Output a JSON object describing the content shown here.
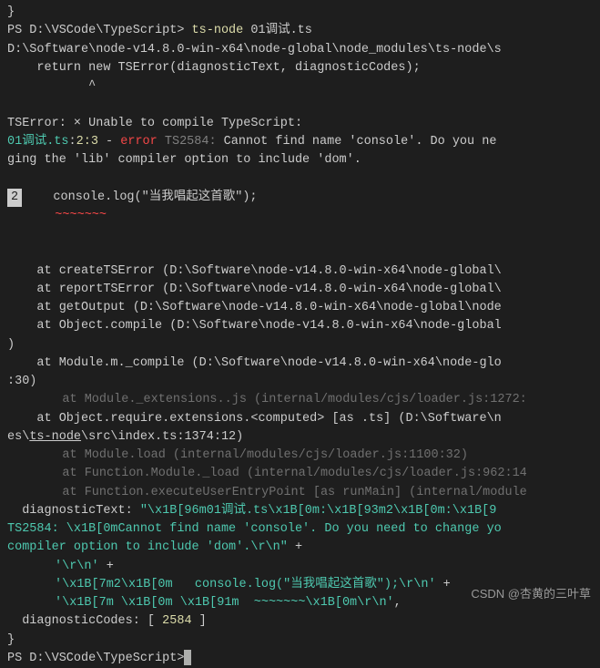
{
  "top": {
    "brace": "}",
    "prompt1": "PS D:\\VSCode\\TypeScript> ",
    "cmd": "ts-node",
    "arg": " 01调试.ts",
    "path": "D:\\Software\\node-v14.8.0-win-x64\\node-global\\node_modules\\ts-node\\s",
    "return_line": "    return new TSError(diagnosticText, diagnosticCodes);",
    "caret": "           ^"
  },
  "err": {
    "hdr": "TSError: × Unable to compile TypeScript:",
    "file": "01调试.ts",
    "loc_colon1": ":",
    "loc_line": "2",
    "loc_col": ":3",
    "dash": " - ",
    "error_word": "error",
    "code": " TS2584:",
    "msg1": " Cannot find name 'console'. Do you ne",
    "msg2": "ging the 'lib' compiler option to include 'dom'."
  },
  "code": {
    "gutter": "2",
    "line": "   console.log(\"当我唱起这首歌\");",
    "squiggle": "   ~~~~~~~"
  },
  "stack": {
    "s1": "    at createTSError (D:\\Software\\node-v14.8.0-win-x64\\node-global\\",
    "s2": "    at reportTSError (D:\\Software\\node-v14.8.0-win-x64\\node-global\\",
    "s3": "    at getOutput (D:\\Software\\node-v14.8.0-win-x64\\node-global\\node",
    "s4": "    at Object.compile (D:\\Software\\node-v14.8.0-win-x64\\node-global",
    "paren": ")",
    "s5": "    at Module.m._compile (D:\\Software\\node-v14.8.0-win-x64\\node-glo",
    "s5b": ":30)",
    "i1": "    at Module._extensions..js (internal/modules/cjs/loader.js:1272:",
    "s6a": "    at Object.require.extensions.<computed> [as .ts] (D:\\Software\\n",
    "s6b_pre": "es\\",
    "s6b_ul": "ts-node",
    "s6b_post": "\\src\\index.ts:1374:12)",
    "i2": "    at Module.load (internal/modules/cjs/loader.js:1100:32)",
    "i3": "    at Function.Module._load (internal/modules/cjs/loader.js:962:14",
    "i4": "    at Function.executeUserEntryPoint [as runMain] (internal/module"
  },
  "diag": {
    "dt_label": "  diagnosticText: ",
    "dt1": "\"\\x1B[96m01调试.ts\\x1B[0m:\\x1B[93m2\\x1B[0m:\\x1B[9",
    "dt2": "TS2584: \\x1B[0mCannot find name 'console'. Do you need to change yo",
    "dt3": "compiler option to include 'dom'.\\r\\n\"",
    "plus": " +",
    "dt4": "'\\r\\n'",
    "dt5": "'\\x1B[7m2\\x1B[0m   console.log(\"当我唱起这首歌\");\\r\\n'",
    "dt6_a": "'\\x1B[7m \\x1B[0m \\x1B[91m  ~~~~~~~\\x1B[0m\\r\\n'",
    "comma": ",",
    "dc_label": "  diagnosticCodes: [ ",
    "dc_val": "2584",
    "dc_close": " ]",
    "close_brace": "}"
  },
  "bottom": {
    "prompt": "PS D:\\VSCode\\TypeScript>"
  },
  "watermark": "CSDN @杏黄的三叶草"
}
